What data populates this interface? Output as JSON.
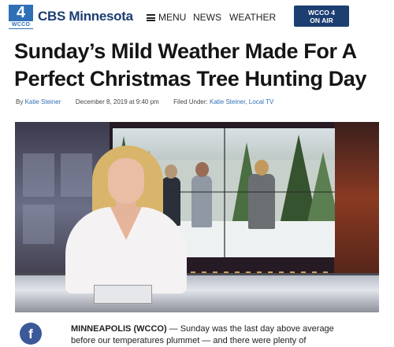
{
  "header": {
    "logo_number": "4",
    "logo_callsign": "WCCO",
    "brand": "CBS Minnesota",
    "menu_label": "MENU",
    "nav": [
      "NEWS",
      "WEATHER"
    ],
    "onair_line1": "WCCO 4",
    "onair_line2": "ON AIR",
    "brand_color": "#1d3e71"
  },
  "article": {
    "headline": "Sunday’s Mild Weather Made For A Perfect Christmas Tree Hunting Day",
    "byline_prefix": "By",
    "author": "Katie Steiner",
    "date": "December 8, 2019 at 9:40 pm",
    "filed_under_label": "Filed Under:",
    "filed_under": "Katie Steiner, Local TV",
    "dateline": "MINNEAPOLIS (WCCO)",
    "body_line1": " — Sunday was the last day above average",
    "body_line2": "before our temperatures plummet — and there were plenty of",
    "facebook_glyph": "f"
  },
  "hero": {
    "icon": "news-anchor-photo"
  }
}
